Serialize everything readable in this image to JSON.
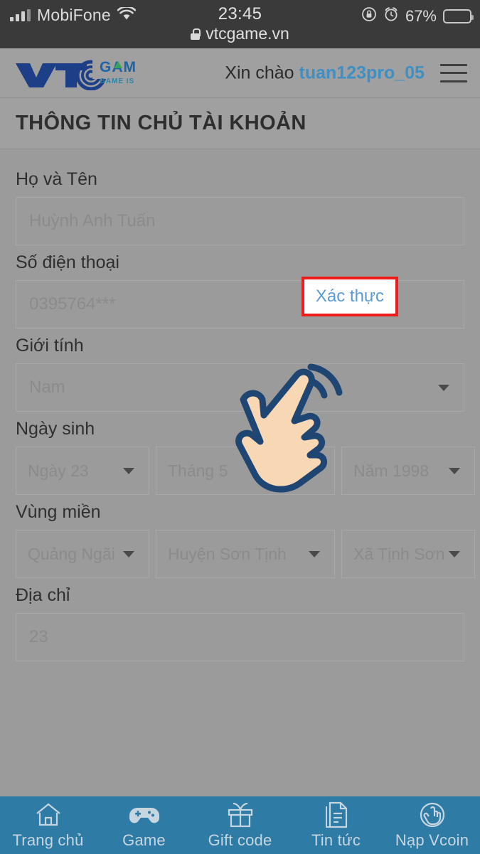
{
  "status_bar": {
    "carrier": "MobiFone",
    "time": "23:45",
    "battery_percent": "67%",
    "signal_icon": "signal-bars-icon",
    "wifi_icon": "wifi-icon",
    "rotation_lock_icon": "rotation-lock-icon",
    "alarm_icon": "alarm-clock-icon",
    "battery_icon": "battery-icon"
  },
  "browser": {
    "lock_icon": "lock-icon",
    "url": "vtcgame.vn"
  },
  "header": {
    "logo_main": "VTC",
    "logo_word": "GAME",
    "logo_tagline": "GAME IS LIFE",
    "greeting_prefix": "Xin chào",
    "username": "tuan123pro_05",
    "menu_icon": "hamburger-menu-icon"
  },
  "page": {
    "title": "THÔNG TIN CHỦ TÀI KHOẢN"
  },
  "form": {
    "full_name": {
      "label": "Họ và Tên",
      "value": "Huỳnh Anh Tuấn"
    },
    "phone": {
      "label": "Số điện thoại",
      "value": "0395764***",
      "verify_label": "Xác thực",
      "verify_highlight_color": "#ee1c1c",
      "verify_text_color": "#5b9bd5"
    },
    "gender": {
      "label": "Giới tính",
      "value": "Nam",
      "caret_icon": "chevron-down-icon"
    },
    "birthday": {
      "label": "Ngày sinh",
      "day": "Ngày 23",
      "month": "Tháng 5",
      "year": "Năm 1998"
    },
    "region": {
      "label": "Vùng miền",
      "province": "Quảng Ngãi",
      "district": "Huyện Sơn Tịnh",
      "ward": "Xã Tịnh Sơn"
    },
    "address": {
      "label": "Địa chỉ",
      "value": "23"
    }
  },
  "cursor": {
    "icon": "pointing-hand-tap-icon",
    "fill_color": "#f7d7b4",
    "outline_color": "#1f4572"
  },
  "bottom_nav": {
    "background_color": "#2e7ba6",
    "items": [
      {
        "label": "Trang chủ",
        "icon": "home-icon"
      },
      {
        "label": "Game",
        "icon": "gamepad-icon"
      },
      {
        "label": "Gift code",
        "icon": "gift-icon"
      },
      {
        "label": "Tin tức",
        "icon": "news-document-icon"
      },
      {
        "label": "Nạp Vcoin",
        "icon": "tap-hand-circle-icon"
      }
    ]
  }
}
